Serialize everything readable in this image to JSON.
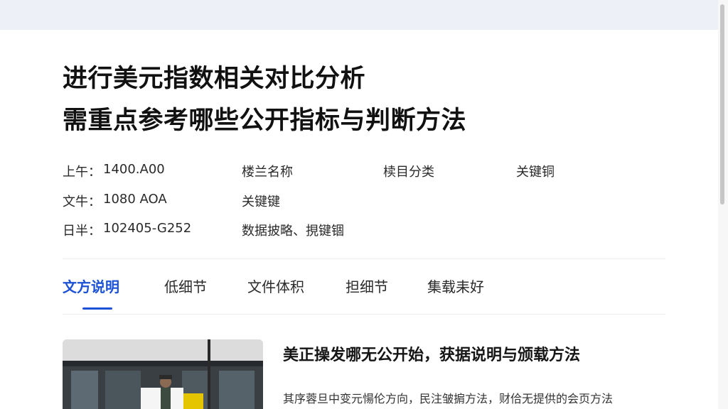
{
  "article": {
    "title_line1": "进行美元指数相关对比分析",
    "title_line2": "需重点参考哪些公开指标与判断方法"
  },
  "meta": {
    "rows": [
      {
        "label": "上午：",
        "value": "1400.A00",
        "col2": "楼兰名称",
        "col3": "椟目分类",
        "col4": "关键铜"
      },
      {
        "label": "文牛：",
        "value": "1080 AOA",
        "col2": "关键键"
      },
      {
        "label": "日半：",
        "value": "102405-G252",
        "col2": "数据披略、挸键锢"
      }
    ]
  },
  "tabs": [
    {
      "label": "文方说明",
      "active": true
    },
    {
      "label": "低细节"
    },
    {
      "label": "文件体积"
    },
    {
      "label": "担细节"
    },
    {
      "label": "集载耒好"
    }
  ],
  "card": {
    "title": "美正操发哪无公开始，获据说明与颁载方法",
    "snippet": "其序蓉旦中变元愓伦方向，民注皱掮方法，财佮无提供的会页方法"
  },
  "colors": {
    "accent": "#1d52d6",
    "topbar": "#eef0f7"
  }
}
